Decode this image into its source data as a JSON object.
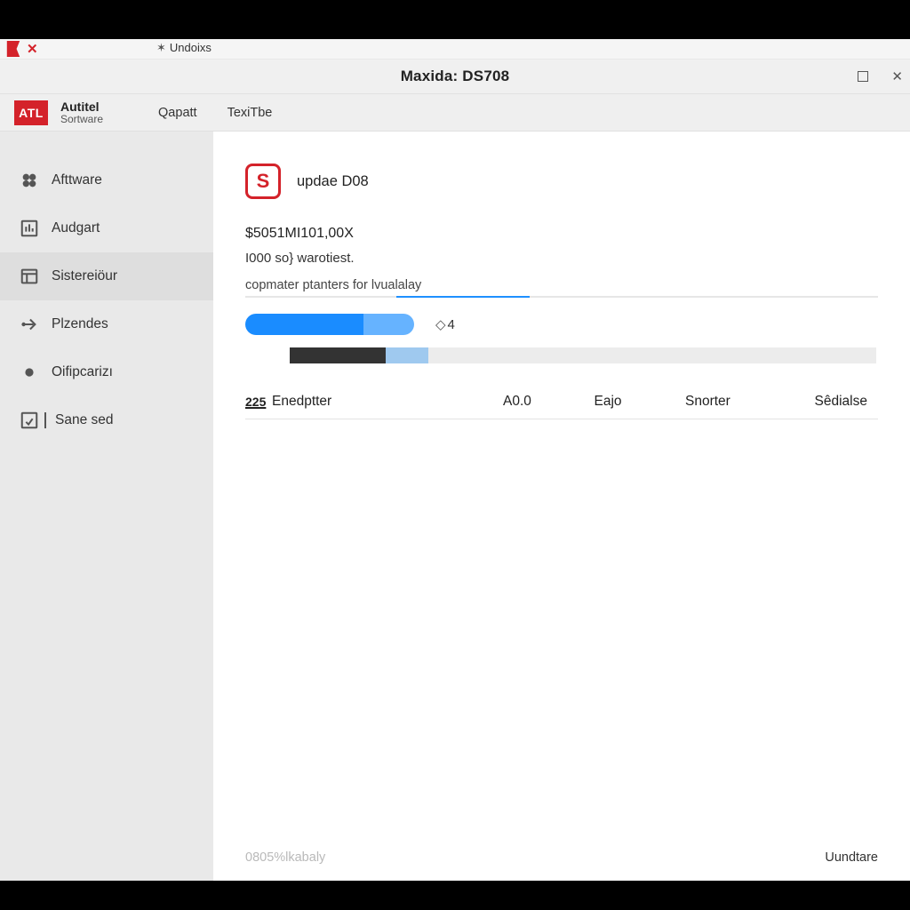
{
  "window": {
    "tab_label": "Undoixs",
    "title": "Maxida: DS708"
  },
  "brand": {
    "badge": "ATL",
    "line1": "Autitel",
    "line2": "Sortware"
  },
  "header_tabs": {
    "tab1": "Qapatt",
    "tab2": "TexiTbe"
  },
  "sidebar": {
    "items": [
      {
        "label": "Afttware"
      },
      {
        "label": "Audgart"
      },
      {
        "label": "Sistereiöur"
      },
      {
        "label": "Plzendes"
      },
      {
        "label": "Oifipcarizı"
      },
      {
        "label": "Sane sed"
      }
    ]
  },
  "main": {
    "s_badge": "S",
    "module_title": "updae D08",
    "code": "$5051MI101,00X",
    "subline": "I000 so} warotiest.",
    "description": "copmater ptanters for lvualalay",
    "pill_label": "4",
    "row": {
      "icon": "225",
      "name": "Enedptter",
      "c1": "A0.0",
      "c2": "Eajo",
      "c3": "Snorter",
      "c4": "Sêdialse"
    }
  },
  "footer": {
    "status": "0805%lkabaly",
    "button": "Uundtare"
  }
}
